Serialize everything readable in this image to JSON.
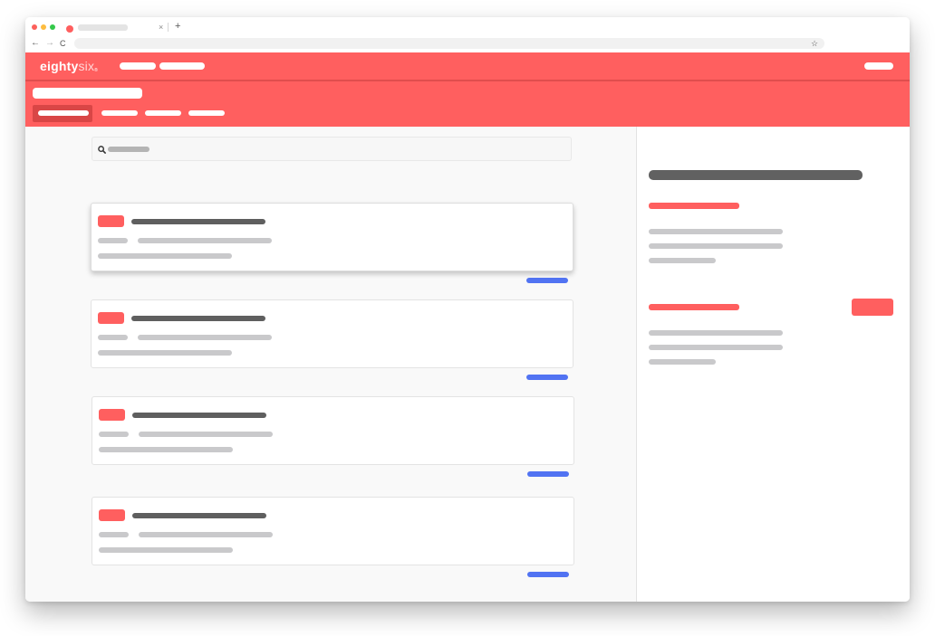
{
  "browser": {
    "tab_close_glyph": "×",
    "new_tab_glyph": "+",
    "back_glyph": "←",
    "forward_glyph": "→",
    "reload_glyph": "C",
    "bookmark_glyph": "☆",
    "traffic_colors": [
      "#fc605b",
      "#fdbc40",
      "#34c84a"
    ]
  },
  "app": {
    "logo_main": "eighty",
    "logo_accent": "six",
    "logo_mark": "®",
    "brand_color": "#ff5f5f",
    "link_color": "#5173f2"
  },
  "icons": {
    "search": "search-icon",
    "bookmark": "star-icon",
    "back": "arrow-left-icon",
    "forward": "arrow-right-icon",
    "reload": "reload-icon"
  },
  "cards": [
    {
      "raised": true
    },
    {
      "raised": false
    },
    {
      "raised": false
    },
    {
      "raised": false
    }
  ]
}
